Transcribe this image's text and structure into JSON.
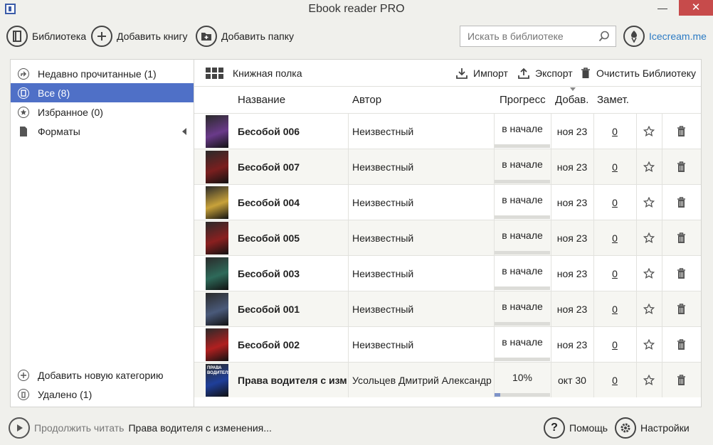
{
  "window": {
    "title": "Ebook reader PRO",
    "minimize": "—",
    "maximize": "□",
    "close": "✕"
  },
  "toolbar": {
    "library_label": "Библиотека",
    "add_book_label": "Добавить книгу",
    "add_folder_label": "Добавить папку",
    "search_placeholder": "Искать в библиотеке",
    "brand": "Icecream.me"
  },
  "sidebar": {
    "items": [
      {
        "label": "Недавно прочитанные (1)",
        "icon": "share-icon"
      },
      {
        "label": "Все (8)",
        "icon": "book-icon",
        "active": true
      },
      {
        "label": "Избранное (0)",
        "icon": "star-icon"
      },
      {
        "label": "Форматы",
        "icon": "file-icon"
      }
    ],
    "add_category": "Добавить новую категорию",
    "deleted": "Удалено (1)"
  },
  "main": {
    "shelf_label": "Книжная полка",
    "import_label": "Импорт",
    "export_label": "Экспорт",
    "clear_label": "Очистить Библиотеку",
    "columns": {
      "title": "Название",
      "author": "Автор",
      "progress": "Прогресс",
      "added": "Добав.",
      "notes": "Замет."
    },
    "books": [
      {
        "title": "Бесобой 006",
        "author": "Неизвестный",
        "progress": "в начале",
        "progress_fraction": 0,
        "added": "ноя 23",
        "notes": "0",
        "cover_color": "#6a3a8a"
      },
      {
        "title": "Бесобой 007",
        "author": "Неизвестный",
        "progress": "в начале",
        "progress_fraction": 0,
        "added": "ноя 23",
        "notes": "0",
        "cover_color": "#7a1f1f"
      },
      {
        "title": "Бесобой 004",
        "author": "Неизвестный",
        "progress": "в начале",
        "progress_fraction": 0,
        "added": "ноя 23",
        "notes": "0",
        "cover_color": "#c8a23a"
      },
      {
        "title": "Бесобой 005",
        "author": "Неизвестный",
        "progress": "в начале",
        "progress_fraction": 0,
        "added": "ноя 23",
        "notes": "0",
        "cover_color": "#8a2020"
      },
      {
        "title": "Бесобой 003",
        "author": "Неизвестный",
        "progress": "в начале",
        "progress_fraction": 0,
        "added": "ноя 23",
        "notes": "0",
        "cover_color": "#2e6a5a"
      },
      {
        "title": "Бесобой 001",
        "author": "Неизвестный",
        "progress": "в начале",
        "progress_fraction": 0,
        "added": "ноя 23",
        "notes": "0",
        "cover_color": "#4a5a7a"
      },
      {
        "title": "Бесобой 002",
        "author": "Неизвестный",
        "progress": "в начале",
        "progress_fraction": 0,
        "added": "ноя 23",
        "notes": "0",
        "cover_color": "#b02020"
      },
      {
        "title": "Права водителя с изменениями",
        "author": "Усольцев Дмитрий Александрович",
        "progress": "10%",
        "progress_fraction": 0.1,
        "added": "окт 30",
        "notes": "0",
        "cover_color": "#1f3f9a",
        "cover_text": "ПРАВА ВОДИТЕЛЯ"
      }
    ]
  },
  "status": {
    "continue_label": "Продолжить читать",
    "current_book": "Права водителя с изменения...",
    "help_label": "Помощь",
    "settings_label": "Настройки"
  },
  "colors": {
    "accent": "#4f70c7",
    "brand": "#2c7bc4",
    "close": "#c74b4b"
  }
}
